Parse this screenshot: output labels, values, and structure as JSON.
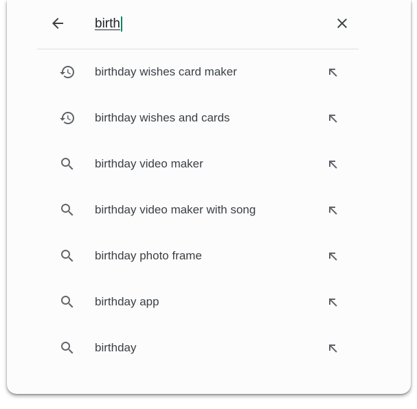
{
  "search": {
    "query": "birth"
  },
  "suggestions": [
    {
      "label": "birthday wishes card maker",
      "icon": "history-icon"
    },
    {
      "label": "birthday wishes and cards",
      "icon": "history-icon"
    },
    {
      "label": "birthday video maker",
      "icon": "search-icon"
    },
    {
      "label": "birthday video maker with song",
      "icon": "search-icon"
    },
    {
      "label": "birthday photo frame",
      "icon": "search-icon"
    },
    {
      "label": "birthday app",
      "icon": "search-icon"
    },
    {
      "label": "birthday",
      "icon": "search-icon"
    }
  ],
  "colors": {
    "caret": "#01875f",
    "icon": "#5f6368",
    "text": "#3c4043"
  }
}
